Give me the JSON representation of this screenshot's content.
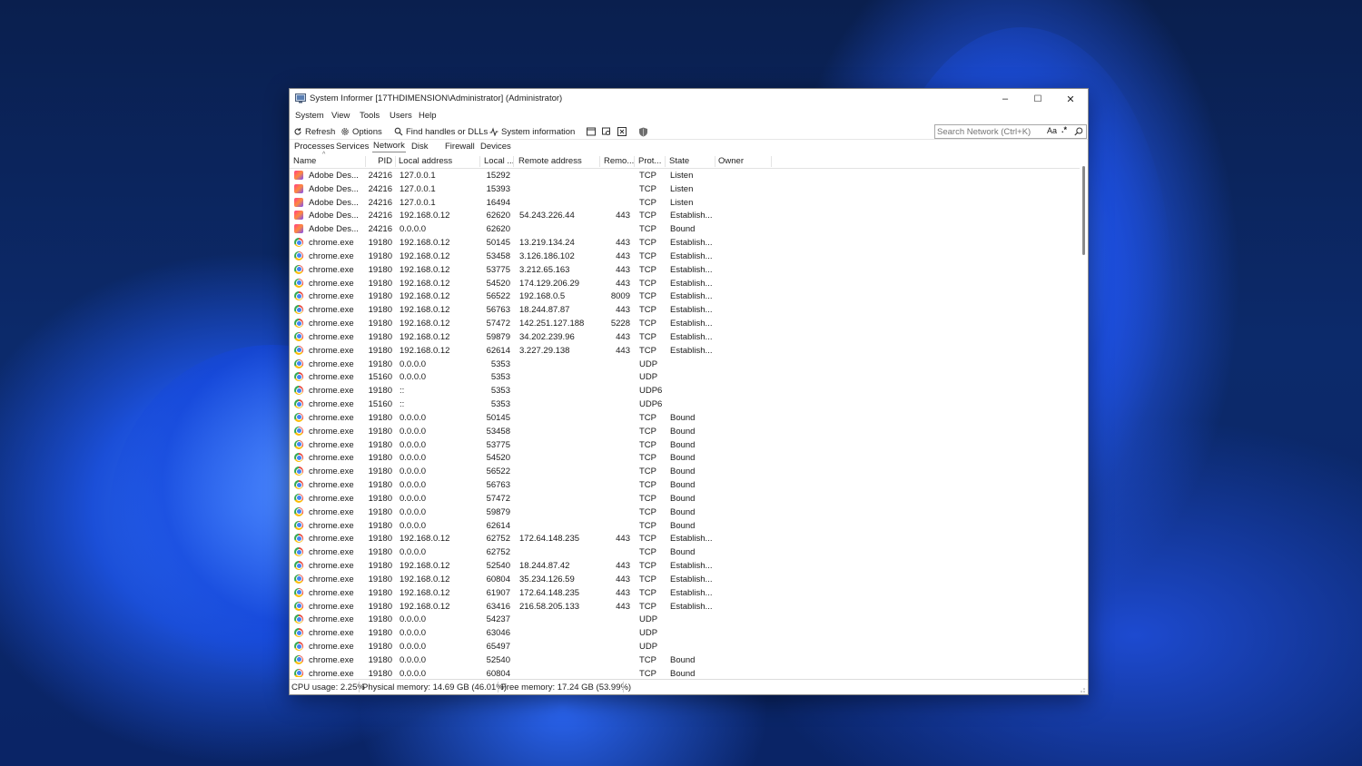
{
  "window": {
    "title": "System Informer [17THDIMENSION\\Administrator] (Administrator)",
    "minimize": "–",
    "maximize": "☐",
    "close": "✕"
  },
  "menu": [
    "System",
    "View",
    "Tools",
    "Users",
    "Help"
  ],
  "toolbar": {
    "refresh": "Refresh",
    "options": "Options",
    "find": "Find handles or DLLs",
    "sysinfo": "System information"
  },
  "search": {
    "placeholder": "Search Network (Ctrl+K)",
    "case_label": "Aa",
    "regex_label": ".*"
  },
  "tabs": [
    "Processes",
    "Services",
    "Network",
    "Disk",
    "Firewall",
    "Devices"
  ],
  "active_tab": "Network",
  "columns": [
    "Name",
    "PID",
    "Local address",
    "Local ...",
    "Remote address",
    "Remo...",
    "Prot...",
    "State",
    "Owner"
  ],
  "rows": [
    {
      "icon": "adobe",
      "name": "Adobe Des...",
      "pid": "24216",
      "laddr": "127.0.0.1",
      "lport": "15292",
      "raddr": "",
      "rport": "",
      "proto": "TCP",
      "state": "Listen"
    },
    {
      "icon": "adobe",
      "name": "Adobe Des...",
      "pid": "24216",
      "laddr": "127.0.0.1",
      "lport": "15393",
      "raddr": "",
      "rport": "",
      "proto": "TCP",
      "state": "Listen"
    },
    {
      "icon": "adobe",
      "name": "Adobe Des...",
      "pid": "24216",
      "laddr": "127.0.0.1",
      "lport": "16494",
      "raddr": "",
      "rport": "",
      "proto": "TCP",
      "state": "Listen"
    },
    {
      "icon": "adobe",
      "name": "Adobe Des...",
      "pid": "24216",
      "laddr": "192.168.0.12",
      "lport": "62620",
      "raddr": "54.243.226.44",
      "rport": "443",
      "proto": "TCP",
      "state": "Establish..."
    },
    {
      "icon": "adobe",
      "name": "Adobe Des...",
      "pid": "24216",
      "laddr": "0.0.0.0",
      "lport": "62620",
      "raddr": "",
      "rport": "",
      "proto": "TCP",
      "state": "Bound"
    },
    {
      "icon": "chrome",
      "name": "chrome.exe",
      "pid": "19180",
      "laddr": "192.168.0.12",
      "lport": "50145",
      "raddr": "13.219.134.24",
      "rport": "443",
      "proto": "TCP",
      "state": "Establish..."
    },
    {
      "icon": "chrome",
      "name": "chrome.exe",
      "pid": "19180",
      "laddr": "192.168.0.12",
      "lport": "53458",
      "raddr": "3.126.186.102",
      "rport": "443",
      "proto": "TCP",
      "state": "Establish..."
    },
    {
      "icon": "chrome",
      "name": "chrome.exe",
      "pid": "19180",
      "laddr": "192.168.0.12",
      "lport": "53775",
      "raddr": "3.212.65.163",
      "rport": "443",
      "proto": "TCP",
      "state": "Establish..."
    },
    {
      "icon": "chrome",
      "name": "chrome.exe",
      "pid": "19180",
      "laddr": "192.168.0.12",
      "lport": "54520",
      "raddr": "174.129.206.29",
      "rport": "443",
      "proto": "TCP",
      "state": "Establish..."
    },
    {
      "icon": "chrome",
      "name": "chrome.exe",
      "pid": "19180",
      "laddr": "192.168.0.12",
      "lport": "56522",
      "raddr": "192.168.0.5",
      "rport": "8009",
      "proto": "TCP",
      "state": "Establish..."
    },
    {
      "icon": "chrome",
      "name": "chrome.exe",
      "pid": "19180",
      "laddr": "192.168.0.12",
      "lport": "56763",
      "raddr": "18.244.87.87",
      "rport": "443",
      "proto": "TCP",
      "state": "Establish..."
    },
    {
      "icon": "chrome",
      "name": "chrome.exe",
      "pid": "19180",
      "laddr": "192.168.0.12",
      "lport": "57472",
      "raddr": "142.251.127.188",
      "rport": "5228",
      "proto": "TCP",
      "state": "Establish..."
    },
    {
      "icon": "chrome",
      "name": "chrome.exe",
      "pid": "19180",
      "laddr": "192.168.0.12",
      "lport": "59879",
      "raddr": "34.202.239.96",
      "rport": "443",
      "proto": "TCP",
      "state": "Establish..."
    },
    {
      "icon": "chrome",
      "name": "chrome.exe",
      "pid": "19180",
      "laddr": "192.168.0.12",
      "lport": "62614",
      "raddr": "3.227.29.138",
      "rport": "443",
      "proto": "TCP",
      "state": "Establish..."
    },
    {
      "icon": "chrome",
      "name": "chrome.exe",
      "pid": "19180",
      "laddr": "0.0.0.0",
      "lport": "5353",
      "raddr": "",
      "rport": "",
      "proto": "UDP",
      "state": ""
    },
    {
      "icon": "chrome",
      "name": "chrome.exe",
      "pid": "15160",
      "laddr": "0.0.0.0",
      "lport": "5353",
      "raddr": "",
      "rport": "",
      "proto": "UDP",
      "state": ""
    },
    {
      "icon": "chrome",
      "name": "chrome.exe",
      "pid": "19180",
      "laddr": "::",
      "lport": "5353",
      "raddr": "",
      "rport": "",
      "proto": "UDP6",
      "state": ""
    },
    {
      "icon": "chrome",
      "name": "chrome.exe",
      "pid": "15160",
      "laddr": "::",
      "lport": "5353",
      "raddr": "",
      "rport": "",
      "proto": "UDP6",
      "state": ""
    },
    {
      "icon": "chrome",
      "name": "chrome.exe",
      "pid": "19180",
      "laddr": "0.0.0.0",
      "lport": "50145",
      "raddr": "",
      "rport": "",
      "proto": "TCP",
      "state": "Bound"
    },
    {
      "icon": "chrome",
      "name": "chrome.exe",
      "pid": "19180",
      "laddr": "0.0.0.0",
      "lport": "53458",
      "raddr": "",
      "rport": "",
      "proto": "TCP",
      "state": "Bound"
    },
    {
      "icon": "chrome",
      "name": "chrome.exe",
      "pid": "19180",
      "laddr": "0.0.0.0",
      "lport": "53775",
      "raddr": "",
      "rport": "",
      "proto": "TCP",
      "state": "Bound"
    },
    {
      "icon": "chrome",
      "name": "chrome.exe",
      "pid": "19180",
      "laddr": "0.0.0.0",
      "lport": "54520",
      "raddr": "",
      "rport": "",
      "proto": "TCP",
      "state": "Bound"
    },
    {
      "icon": "chrome",
      "name": "chrome.exe",
      "pid": "19180",
      "laddr": "0.0.0.0",
      "lport": "56522",
      "raddr": "",
      "rport": "",
      "proto": "TCP",
      "state": "Bound"
    },
    {
      "icon": "chrome",
      "name": "chrome.exe",
      "pid": "19180",
      "laddr": "0.0.0.0",
      "lport": "56763",
      "raddr": "",
      "rport": "",
      "proto": "TCP",
      "state": "Bound"
    },
    {
      "icon": "chrome",
      "name": "chrome.exe",
      "pid": "19180",
      "laddr": "0.0.0.0",
      "lport": "57472",
      "raddr": "",
      "rport": "",
      "proto": "TCP",
      "state": "Bound"
    },
    {
      "icon": "chrome",
      "name": "chrome.exe",
      "pid": "19180",
      "laddr": "0.0.0.0",
      "lport": "59879",
      "raddr": "",
      "rport": "",
      "proto": "TCP",
      "state": "Bound"
    },
    {
      "icon": "chrome",
      "name": "chrome.exe",
      "pid": "19180",
      "laddr": "0.0.0.0",
      "lport": "62614",
      "raddr": "",
      "rport": "",
      "proto": "TCP",
      "state": "Bound"
    },
    {
      "icon": "chrome",
      "name": "chrome.exe",
      "pid": "19180",
      "laddr": "192.168.0.12",
      "lport": "62752",
      "raddr": "172.64.148.235",
      "rport": "443",
      "proto": "TCP",
      "state": "Establish..."
    },
    {
      "icon": "chrome",
      "name": "chrome.exe",
      "pid": "19180",
      "laddr": "0.0.0.0",
      "lport": "62752",
      "raddr": "",
      "rport": "",
      "proto": "TCP",
      "state": "Bound"
    },
    {
      "icon": "chrome",
      "name": "chrome.exe",
      "pid": "19180",
      "laddr": "192.168.0.12",
      "lport": "52540",
      "raddr": "18.244.87.42",
      "rport": "443",
      "proto": "TCP",
      "state": "Establish..."
    },
    {
      "icon": "chrome",
      "name": "chrome.exe",
      "pid": "19180",
      "laddr": "192.168.0.12",
      "lport": "60804",
      "raddr": "35.234.126.59",
      "rport": "443",
      "proto": "TCP",
      "state": "Establish..."
    },
    {
      "icon": "chrome",
      "name": "chrome.exe",
      "pid": "19180",
      "laddr": "192.168.0.12",
      "lport": "61907",
      "raddr": "172.64.148.235",
      "rport": "443",
      "proto": "TCP",
      "state": "Establish..."
    },
    {
      "icon": "chrome",
      "name": "chrome.exe",
      "pid": "19180",
      "laddr": "192.168.0.12",
      "lport": "63416",
      "raddr": "216.58.205.133",
      "rport": "443",
      "proto": "TCP",
      "state": "Establish..."
    },
    {
      "icon": "chrome",
      "name": "chrome.exe",
      "pid": "19180",
      "laddr": "0.0.0.0",
      "lport": "54237",
      "raddr": "",
      "rport": "",
      "proto": "UDP",
      "state": ""
    },
    {
      "icon": "chrome",
      "name": "chrome.exe",
      "pid": "19180",
      "laddr": "0.0.0.0",
      "lport": "63046",
      "raddr": "",
      "rport": "",
      "proto": "UDP",
      "state": ""
    },
    {
      "icon": "chrome",
      "name": "chrome.exe",
      "pid": "19180",
      "laddr": "0.0.0.0",
      "lport": "65497",
      "raddr": "",
      "rport": "",
      "proto": "UDP",
      "state": ""
    },
    {
      "icon": "chrome",
      "name": "chrome.exe",
      "pid": "19180",
      "laddr": "0.0.0.0",
      "lport": "52540",
      "raddr": "",
      "rport": "",
      "proto": "TCP",
      "state": "Bound"
    },
    {
      "icon": "chrome",
      "name": "chrome.exe",
      "pid": "19180",
      "laddr": "0.0.0.0",
      "lport": "60804",
      "raddr": "",
      "rport": "",
      "proto": "TCP",
      "state": "Bound"
    }
  ],
  "status": {
    "cpu": "CPU usage: 2.25%",
    "physical": "Physical memory: 14.69 GB (46.01%)",
    "free": "Free memory: 17.24 GB (53.99%)"
  },
  "colors": {
    "accent": "#0067c0",
    "wallpaper": "#1f4fd6"
  }
}
